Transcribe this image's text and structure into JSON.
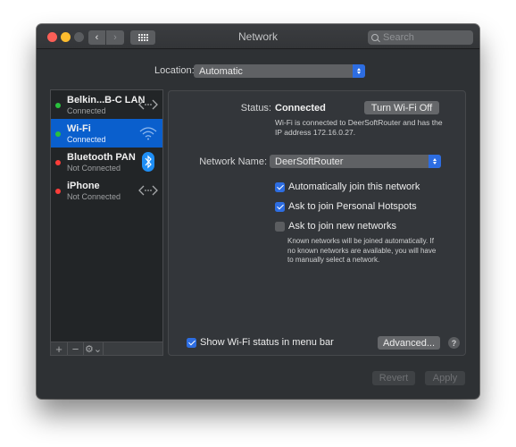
{
  "window": {
    "title": "Network",
    "traffic_lights": [
      "close",
      "minimize",
      "zoom-disabled"
    ],
    "toolbar": {
      "back_icon": "chevron-left-icon",
      "forward_icon": "chevron-right-icon",
      "grid_icon": "show-all-grid-icon"
    },
    "search": {
      "placeholder": "Search",
      "value": "",
      "icon": "search-icon"
    }
  },
  "location": {
    "label": "Location:",
    "value": "Automatic"
  },
  "services": [
    {
      "name": "Belkin...B-C LAN",
      "status": "Connected",
      "status_color": "#29c13d",
      "icon": "ethernet-arrows-icon",
      "selected": false
    },
    {
      "name": "Wi-Fi",
      "status": "Connected",
      "status_color": "#29c13d",
      "icon": "wifi-icon",
      "selected": true
    },
    {
      "name": "Bluetooth PAN",
      "status": "Not Connected",
      "status_color": "#fc3d39",
      "icon": "bluetooth-icon",
      "selected": false
    },
    {
      "name": "iPhone",
      "status": "Not Connected",
      "status_color": "#fc3d39",
      "icon": "ethernet-arrows-icon",
      "selected": false
    }
  ],
  "sidebar_toolbar": {
    "add": "+",
    "remove": "−",
    "gear": "⚙︎⌄"
  },
  "detail": {
    "status_label": "Status:",
    "status_value": "Connected",
    "turn_off_button": "Turn Wi-Fi Off",
    "status_description": "Wi-Fi is connected to DeerSoftRouter and has the IP address 172.16.0.27.",
    "network_name_label": "Network Name:",
    "network_name_value": "DeerSoftRouter",
    "checkboxes": [
      {
        "label": "Automatically join this network",
        "checked": true
      },
      {
        "label": "Ask to join Personal Hotspots",
        "checked": true
      },
      {
        "label": "Ask to join new networks",
        "checked": false
      }
    ],
    "ask_note": "Known networks will be joined automatically. If no known networks are available, you will have to manually select a network.",
    "show_status": {
      "label": "Show Wi-Fi status in menu bar",
      "checked": true
    },
    "advanced_button": "Advanced...",
    "help_button": "?"
  },
  "footer": {
    "revert": "Revert",
    "apply": "Apply"
  },
  "colors": {
    "accent": "#2d6de1",
    "selection": "#0a5fcd",
    "connected": "#29c13d",
    "disconnected": "#fc3d39"
  }
}
